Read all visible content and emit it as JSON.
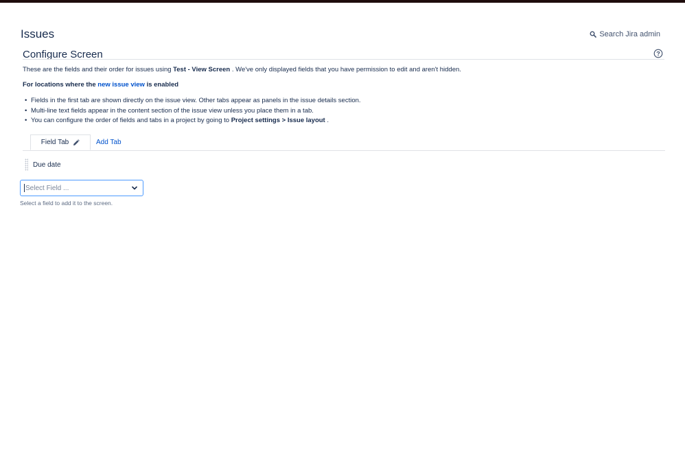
{
  "header": {
    "title": "Issues",
    "search_label": "Search Jira admin",
    "search_icon": "search-icon"
  },
  "section": {
    "title": "Configure Screen",
    "help_icon": "help-icon"
  },
  "description": {
    "prefix": "These are the fields and their order for issues using ",
    "screen_name": "Test - View Screen",
    "suffix": " . We've only displayed fields that you have permission to edit and aren't hidden."
  },
  "locations": {
    "prefix": "For locations where the ",
    "link": "new issue view",
    "suffix": " is enabled"
  },
  "bullets": {
    "item1": "Fields in the first tab are shown directly on the issue view. Other tabs appear as panels in the issue details section.",
    "item2": "Multi-line text fields appear in the content section of the issue view unless you place them in a tab.",
    "item3_prefix": "You can configure the order of fields and tabs in a project by going to ",
    "item3_bold1": "Project settings",
    "item3_sep": " > ",
    "item3_bold2": "Issue layout",
    "item3_suffix": " ."
  },
  "tabs": {
    "active_label": "Field Tab",
    "edit_icon": "pencil-icon",
    "add_label": "Add Tab"
  },
  "fields": [
    {
      "label": "Due date"
    }
  ],
  "select_field": {
    "placeholder": "Select Field ...",
    "hint": "Select a field to add it to the screen."
  },
  "colors": {
    "accent": "#0052cc",
    "focus": "#4c9aff",
    "text": "#172b4d",
    "border": "#dfe1e6",
    "topbar": "#1e0c0c"
  }
}
